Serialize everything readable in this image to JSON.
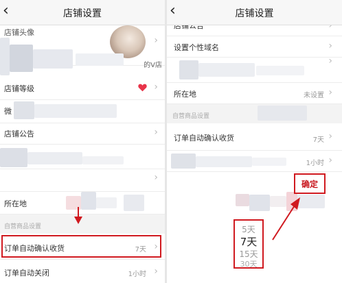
{
  "left": {
    "title": "店铺设置",
    "rows": {
      "profile": "店铺头像",
      "shop_name_value": "的V店",
      "level": "店铺等级",
      "wechat_partial": "微",
      "notice": "店铺公告",
      "location": "所在地",
      "auto_confirm": "订单自动确认收货",
      "auto_confirm_value": "7天",
      "auto_close": "订单自动关闭",
      "auto_close_value": "1小时"
    },
    "section": "自营商品设置"
  },
  "right": {
    "title": "店铺设置",
    "rows": {
      "notice_partial": "店铺公告",
      "domain": "设置个性域名",
      "location": "所在地",
      "location_value": "未设置",
      "auto_confirm": "订单自动确认收货",
      "auto_confirm_value": "7天",
      "auto_close_value": "1小时"
    },
    "section": "自营商品设置",
    "confirm": "确定",
    "picker": [
      "5天",
      "7天",
      "15天",
      "30天"
    ]
  },
  "colors": {
    "accent_red": "#d0191f",
    "heart": "#e8344a"
  },
  "icons": [
    "back-chevron-icon",
    "chevron-right-icon",
    "heart-icon",
    "arrow-icon"
  ]
}
